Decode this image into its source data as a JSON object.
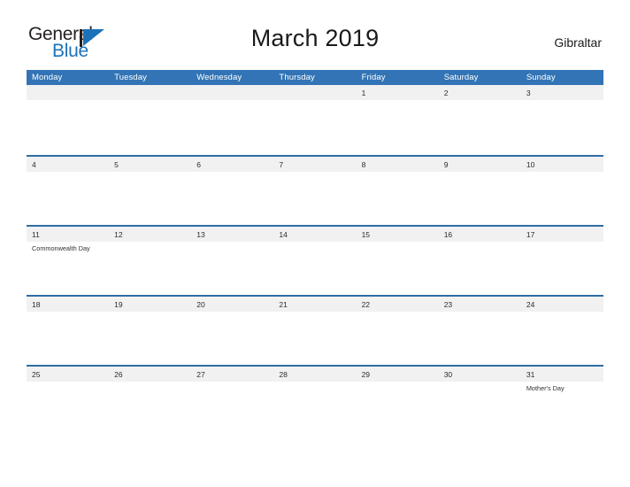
{
  "brand": {
    "name_part1": "General",
    "name_part2": "Blue",
    "triangle_color": "#1c72b8",
    "bar_color": "#231f20"
  },
  "header": {
    "title": "March 2019",
    "region": "Gibraltar"
  },
  "colors": {
    "header_blue": "#3274b5",
    "row_divider_blue": "#2e6da4",
    "date_strip_gray": "#f1f1f1",
    "text_dark": "#1a1a1a"
  },
  "calendar": {
    "weekdays": [
      "Monday",
      "Tuesday",
      "Wednesday",
      "Thursday",
      "Friday",
      "Saturday",
      "Sunday"
    ],
    "weeks": [
      {
        "days": [
          {
            "num": "",
            "events": []
          },
          {
            "num": "",
            "events": []
          },
          {
            "num": "",
            "events": []
          },
          {
            "num": "",
            "events": []
          },
          {
            "num": "1",
            "events": []
          },
          {
            "num": "2",
            "events": []
          },
          {
            "num": "3",
            "events": []
          }
        ]
      },
      {
        "days": [
          {
            "num": "4",
            "events": []
          },
          {
            "num": "5",
            "events": []
          },
          {
            "num": "6",
            "events": []
          },
          {
            "num": "7",
            "events": []
          },
          {
            "num": "8",
            "events": []
          },
          {
            "num": "9",
            "events": []
          },
          {
            "num": "10",
            "events": []
          }
        ]
      },
      {
        "days": [
          {
            "num": "11",
            "events": [
              "Commonwealth Day"
            ]
          },
          {
            "num": "12",
            "events": []
          },
          {
            "num": "13",
            "events": []
          },
          {
            "num": "14",
            "events": []
          },
          {
            "num": "15",
            "events": []
          },
          {
            "num": "16",
            "events": []
          },
          {
            "num": "17",
            "events": []
          }
        ]
      },
      {
        "days": [
          {
            "num": "18",
            "events": []
          },
          {
            "num": "19",
            "events": []
          },
          {
            "num": "20",
            "events": []
          },
          {
            "num": "21",
            "events": []
          },
          {
            "num": "22",
            "events": []
          },
          {
            "num": "23",
            "events": []
          },
          {
            "num": "24",
            "events": []
          }
        ]
      },
      {
        "days": [
          {
            "num": "25",
            "events": []
          },
          {
            "num": "26",
            "events": []
          },
          {
            "num": "27",
            "events": []
          },
          {
            "num": "28",
            "events": []
          },
          {
            "num": "29",
            "events": []
          },
          {
            "num": "30",
            "events": []
          },
          {
            "num": "31",
            "events": [
              "Mother's Day"
            ]
          }
        ]
      }
    ]
  }
}
